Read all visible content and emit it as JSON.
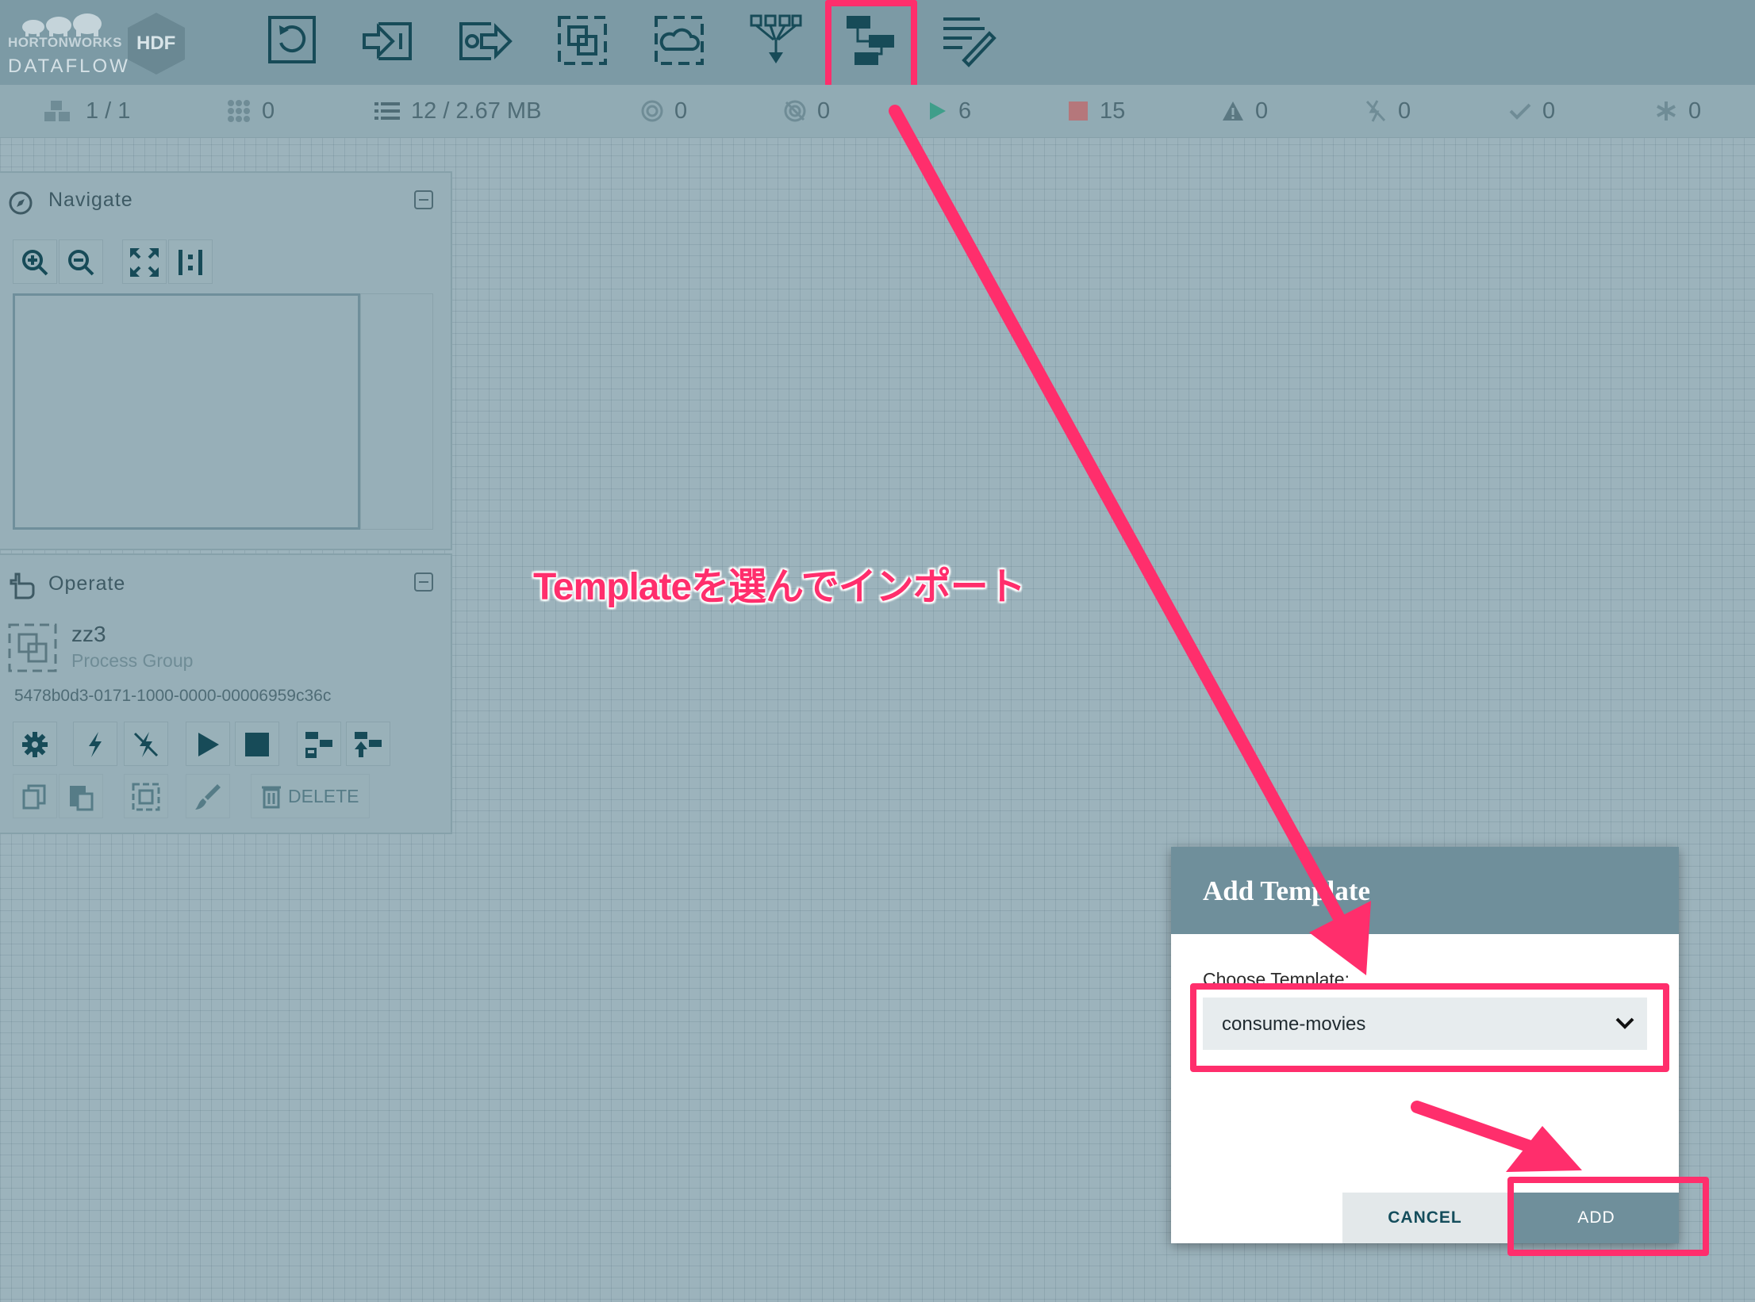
{
  "brand": {
    "top": "HORTONWORKS",
    "bottom": "DATAFLOW",
    "badge": "HDF"
  },
  "toolbar": {
    "items": [
      {
        "name": "processor"
      },
      {
        "name": "input-port"
      },
      {
        "name": "output-port"
      },
      {
        "name": "process-group"
      },
      {
        "name": "remote-process-group"
      },
      {
        "name": "funnel"
      },
      {
        "name": "template"
      },
      {
        "name": "label"
      }
    ]
  },
  "status": {
    "cluster": "1 / 1",
    "threads": "0",
    "queued": "12 / 2.67 MB",
    "transmitting": "0",
    "not_transmitting": "0",
    "running": "6",
    "stopped": "15",
    "invalid": "0",
    "disabled": "0",
    "up_to_date": "0",
    "locally_modified": "0"
  },
  "navigate": {
    "title": "Navigate"
  },
  "operate": {
    "title": "Operate",
    "component_name": "zz3",
    "component_type": "Process Group",
    "component_id": "5478b0d3-0171-1000-0000-00006959c36c",
    "delete_label": "DELETE"
  },
  "dialog": {
    "title": "Add Template",
    "choose_label": "Choose Template:",
    "selected_template": "consume-movies",
    "cancel_label": "CANCEL",
    "add_label": "ADD"
  },
  "annotation": {
    "text": "Templateを選んでインポート"
  },
  "colors": {
    "accent": "#ff2e6c",
    "header": "#7c9aa5",
    "dialog_header": "#6f8f9b"
  }
}
